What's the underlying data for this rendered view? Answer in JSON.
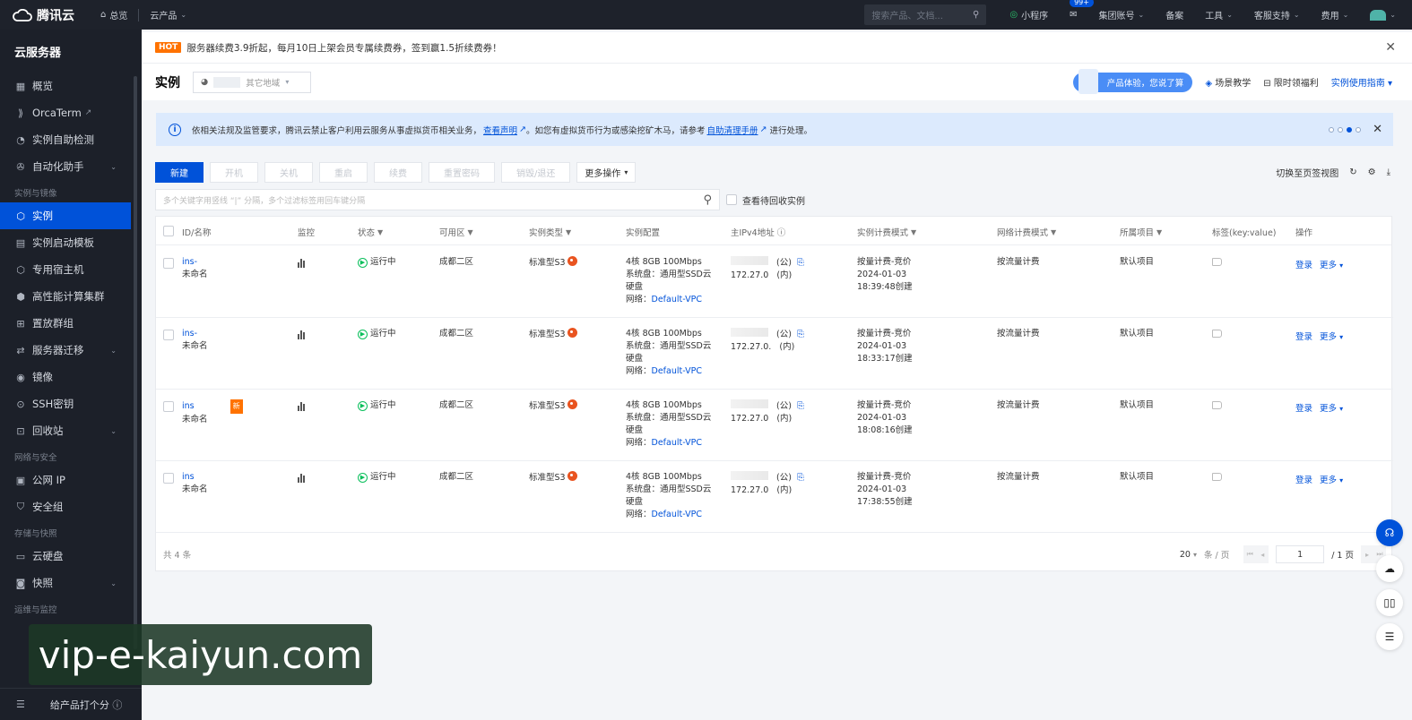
{
  "topbar": {
    "brand": "腾讯云",
    "overview": "总览",
    "products": "云产品",
    "search_placeholder": "搜索产品、文档...",
    "mini_program": "小程序",
    "mail_badge": "99+",
    "group_account": "集团账号",
    "record": "备案",
    "tools": "工具",
    "support": "客服支持",
    "fees": "费用"
  },
  "sidebar": {
    "title": "云服务器",
    "items_top": [
      {
        "label": "概览",
        "icon": "grid-icon"
      },
      {
        "label": "OrcaTerm",
        "icon": "terminal-icon"
      },
      {
        "label": "实例自助检测",
        "icon": "check-icon"
      },
      {
        "label": "自动化助手",
        "icon": "gear-icon"
      }
    ],
    "group1": "实例与镜像",
    "items_g1": [
      {
        "label": "实例",
        "icon": "cube-icon"
      },
      {
        "label": "实例启动模板",
        "icon": "template-icon"
      },
      {
        "label": "专用宿主机",
        "icon": "host-icon"
      },
      {
        "label": "高性能计算集群",
        "icon": "cluster-icon"
      },
      {
        "label": "置放群组",
        "icon": "group-icon"
      },
      {
        "label": "服务器迁移",
        "icon": "migrate-icon"
      },
      {
        "label": "镜像",
        "icon": "image-icon"
      },
      {
        "label": "SSH密钥",
        "icon": "key-icon"
      },
      {
        "label": "回收站",
        "icon": "recycle-icon"
      }
    ],
    "group2": "网络与安全",
    "items_g2": [
      {
        "label": "公网 IP",
        "icon": "ip-icon"
      },
      {
        "label": "安全组",
        "icon": "shield-icon"
      }
    ],
    "group3": "存储与快照",
    "items_g3": [
      {
        "label": "云硬盘",
        "icon": "disk-icon"
      },
      {
        "label": "快照",
        "icon": "camera-icon"
      }
    ],
    "group4": "运维与监控",
    "feedback": "给产品打个分"
  },
  "notice": {
    "hot": "HOT",
    "text": "服务器续费3.9折起，每月10日上架会员专属续费券，签到赢1.5折续费券！"
  },
  "header": {
    "title": "实例",
    "region_other": "其它地域",
    "experience": "产品体验，您说了算",
    "scene": "场景教学",
    "benefit": "限时领福利",
    "guide": "实例使用指南"
  },
  "alert": {
    "text1": "依相关法规及监管要求，腾讯云禁止客户利用云服务从事虚拟货币相关业务，",
    "link1": "查看声明",
    "text2": "。如您有虚拟货币行为或感染挖矿木马，请参考",
    "link2": "自助清理手册",
    "text3": "进行处理。"
  },
  "toolbar": {
    "new": "新建",
    "start": "开机",
    "stop": "关机",
    "restart": "重启",
    "renew": "续费",
    "reset_pwd": "重置密码",
    "terminate": "销毁/退还",
    "more": "更多操作",
    "switch_view": "切换至页签视图"
  },
  "search": {
    "placeholder": "多个关键字用竖线 “|” 分隔，多个过滤标签用回车键分隔",
    "recycled": "查看待回收实例"
  },
  "table": {
    "headers": [
      "ID/名称",
      "监控",
      "状态",
      "可用区",
      "实例类型",
      "实例配置",
      "主IPv4地址",
      "实例计费模式",
      "网络计费模式",
      "所属项目",
      "标签(key:value)",
      "操作"
    ],
    "rows": [
      {
        "id": "ins-",
        "name": "未命名",
        "status": "运行中",
        "zone": "成都二区",
        "type": "标准型S3",
        "cfg1": "4核 8GB 100Mbps",
        "cfg2": "系统盘：通用型SSD云",
        "cfg3": "硬盘",
        "net_label": "网络：",
        "vpc": "Default-VPC",
        "ip_pub": "(公)",
        "ip_priv": "172.27.0",
        "ip_priv_tag": "(内)",
        "bill1": "按量计费-竞价",
        "bill2": "2024-01-03",
        "bill3": "18:39:48创建",
        "netbill": "按流量计费",
        "project": "默认项目",
        "login": "登录",
        "more": "更多",
        "is_new": false
      },
      {
        "id": "ins-",
        "name": "未命名",
        "status": "运行中",
        "zone": "成都二区",
        "type": "标准型S3",
        "cfg1": "4核 8GB 100Mbps",
        "cfg2": "系统盘：通用型SSD云",
        "cfg3": "硬盘",
        "net_label": "网络：",
        "vpc": "Default-VPC",
        "ip_pub": "(公)",
        "ip_priv": "172.27.0.",
        "ip_priv_tag": "(内)",
        "bill1": "按量计费-竞价",
        "bill2": "2024-01-03",
        "bill3": "18:33:17创建",
        "netbill": "按流量计费",
        "project": "默认项目",
        "login": "登录",
        "more": "更多",
        "is_new": false
      },
      {
        "id": "ins",
        "name": "未命名",
        "status": "运行中",
        "zone": "成都二区",
        "type": "标准型S3",
        "cfg1": "4核 8GB 100Mbps",
        "cfg2": "系统盘：通用型SSD云",
        "cfg3": "硬盘",
        "net_label": "网络：",
        "vpc": "Default-VPC",
        "ip_pub": "(公)",
        "ip_priv": "172.27.0",
        "ip_priv_tag": "(内)",
        "bill1": "按量计费-竞价",
        "bill2": "2024-01-03",
        "bill3": "18:08:16创建",
        "netbill": "按流量计费",
        "project": "默认项目",
        "login": "登录",
        "more": "更多",
        "is_new": true,
        "new_label": "新"
      },
      {
        "id": "ins",
        "name": "未命名",
        "status": "运行中",
        "zone": "成都二区",
        "type": "标准型S3",
        "cfg1": "4核 8GB 100Mbps",
        "cfg2": "系统盘：通用型SSD云",
        "cfg3": "硬盘",
        "net_label": "网络：",
        "vpc": "Default-VPC",
        "ip_pub": "(公)",
        "ip_priv": "172.27.0",
        "ip_priv_tag": "(内)",
        "bill1": "按量计费-竞价",
        "bill2": "2024-01-03",
        "bill3": "17:38:55创建",
        "netbill": "按流量计费",
        "project": "默认项目",
        "login": "登录",
        "more": "更多",
        "is_new": false
      }
    ],
    "total": "共 4 条",
    "page_size": "20",
    "per_page": "条 / 页",
    "page": "1",
    "page_total": "/ 1 页"
  },
  "watermark": "vip-e-kaiyun.com",
  "colors": {
    "primary": "#0052d9",
    "hot": "#ff7200",
    "running": "#0abf5b"
  }
}
